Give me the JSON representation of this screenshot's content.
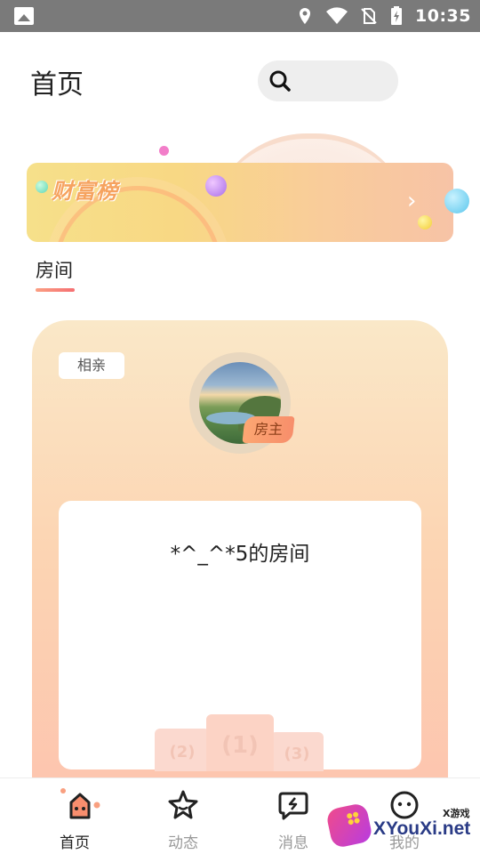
{
  "status_bar": {
    "time": "10:35",
    "icons": [
      "gallery-icon",
      "location-icon",
      "wifi-icon",
      "no-sim-icon",
      "battery-charging-icon"
    ]
  },
  "header": {
    "title": "首页",
    "search_icon": "search-icon"
  },
  "banner": {
    "title": "财富榜",
    "arrow_icon": "chevron-right-icon"
  },
  "section": {
    "tab_label": "房间"
  },
  "room_card": {
    "tag": "相亲",
    "owner_badge": "房主",
    "room_name": "*^_^*5的房间",
    "podium": [
      "(2)",
      "(1)",
      "(3)"
    ]
  },
  "bottom_nav": [
    {
      "label": "首页",
      "icon": "home-icon",
      "active": true
    },
    {
      "label": "动态",
      "icon": "star-icon",
      "active": false
    },
    {
      "label": "消息",
      "icon": "message-icon",
      "active": false
    },
    {
      "label": "我的",
      "icon": "profile-icon",
      "active": false
    }
  ],
  "watermark": {
    "text": "XYouXi.net",
    "top_text": "X游戏"
  },
  "colors": {
    "accent": "#f56f72",
    "card_top": "#fae8c8",
    "card_bottom": "#fdc3ae",
    "status_bar": "#7a7a7a"
  }
}
